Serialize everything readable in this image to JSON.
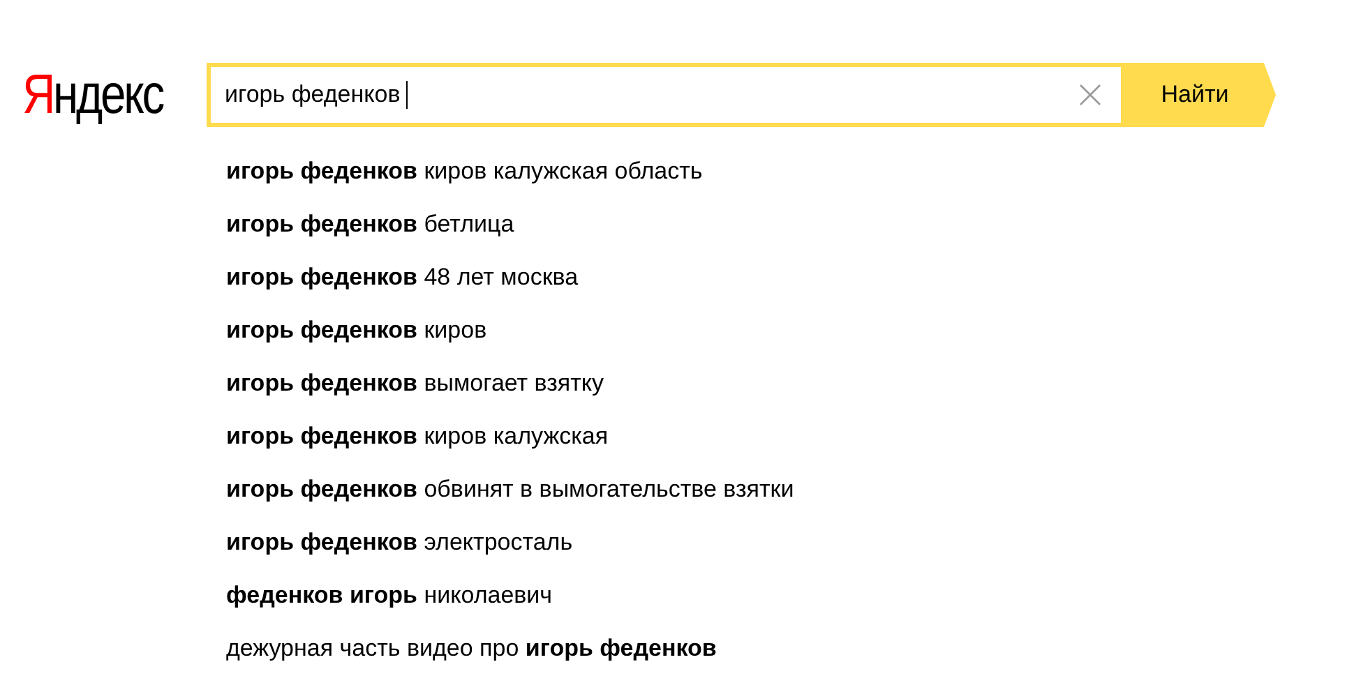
{
  "logo": {
    "first_letter": "Я",
    "rest": "ндекс"
  },
  "search": {
    "value": "игорь феденков ",
    "button": "Найти"
  },
  "suggestions": [
    "**игорь феденков** киров калужская область",
    "**игорь феденков** бетлица",
    "**игорь феденков** 48 лет москва",
    "**игорь феденков** киров",
    "**игорь феденков** вымогает взятку",
    "**игорь феденков** киров калужская",
    "**игорь феденков** обвинят в вымогательстве взятки",
    "**игорь феденков** электросталь",
    "**феденков игорь** николаевич",
    "дежурная часть видео про **игорь феденков**"
  ]
}
